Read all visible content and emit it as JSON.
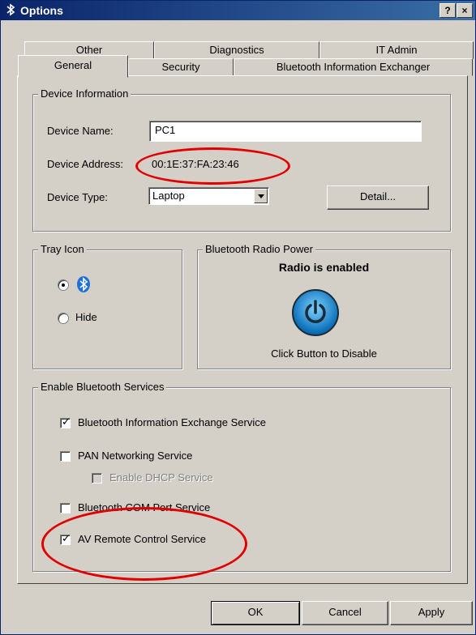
{
  "window": {
    "title": "Options",
    "help_label": "?",
    "close_label": "×"
  },
  "tabs_back": [
    {
      "label": "Other"
    },
    {
      "label": "Diagnostics"
    },
    {
      "label": "IT Admin"
    }
  ],
  "tabs_front": [
    {
      "label": "General"
    },
    {
      "label": "Security"
    },
    {
      "label": "Bluetooth Information Exchanger"
    }
  ],
  "device_info": {
    "legend": "Device Information",
    "name_label": "Device Name:",
    "name_value": "PC1",
    "address_label": "Device Address:",
    "address_value": "00:1E:37:FA:23:46",
    "type_label": "Device Type:",
    "type_value": "Laptop",
    "detail_button": "Detail..."
  },
  "tray_icon": {
    "legend": "Tray Icon",
    "option_show_icon": "bluetooth-icon",
    "option_hide_label": "Hide"
  },
  "radio_power": {
    "legend": "Bluetooth Radio Power",
    "status": "Radio is enabled",
    "hint": "Click Button to Disable"
  },
  "services": {
    "legend": "Enable Bluetooth Services",
    "items": [
      {
        "label": "Bluetooth Information Exchange Service",
        "checked": true
      },
      {
        "label": "PAN Networking Service",
        "checked": false
      },
      {
        "label": "Enable DHCP Service",
        "checked": false,
        "disabled": true
      },
      {
        "label": "Bluetooth COM Port Service",
        "checked": false
      },
      {
        "label": "AV Remote Control Service",
        "checked": true
      }
    ]
  },
  "buttons": {
    "ok": "OK",
    "cancel": "Cancel",
    "apply": "Apply"
  },
  "colors": {
    "title_bar": "#0a246a",
    "face": "#d4d0c8",
    "highlight": "#e00000"
  }
}
